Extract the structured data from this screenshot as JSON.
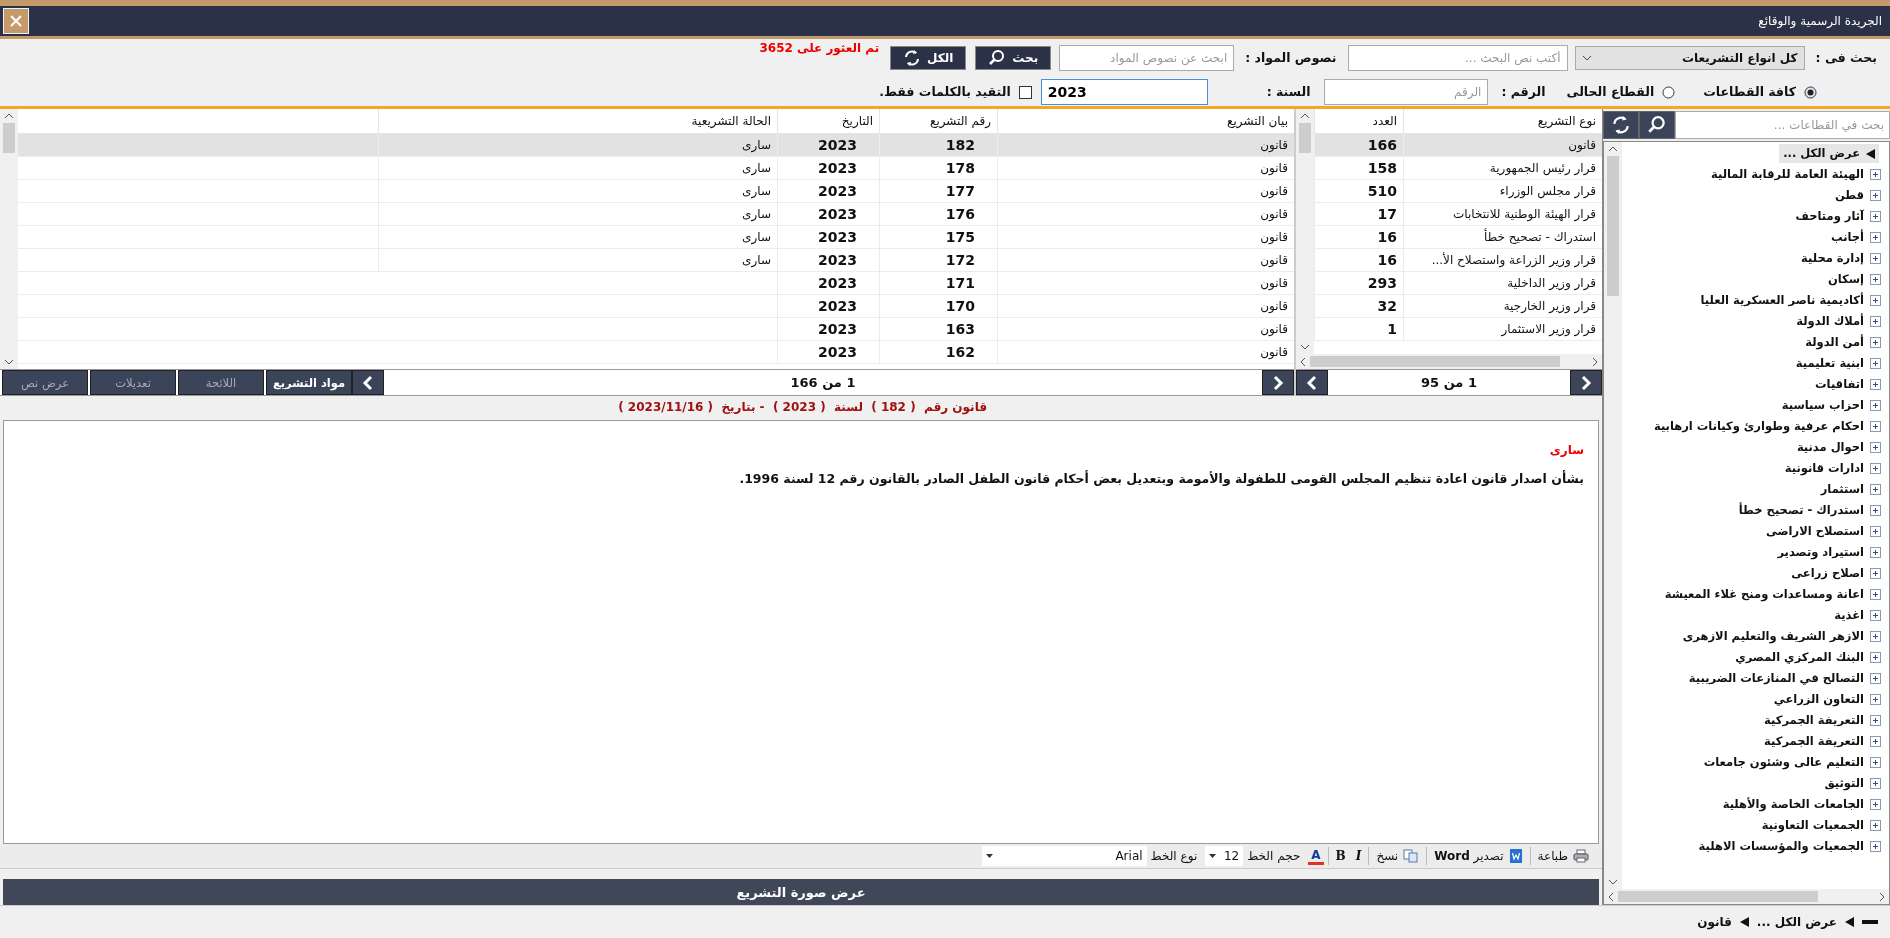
{
  "window": {
    "title": "الجريدة الرسمية والوقائع"
  },
  "search": {
    "scope_label": "بحث فى :",
    "type_dropdown": {
      "value": "كل انواع التشريعات"
    },
    "text_field": {
      "placeholder": "أكتب نص البحث ..."
    },
    "articles_label": "نصوص المواد :",
    "articles_field": {
      "placeholder": "ابحث عن نصوص المواد"
    },
    "search_button": "بحث",
    "all_button": "الكل",
    "result_text": "تم العثور على 3652",
    "sectors": [
      {
        "label": "كافة القطاعات",
        "selected": true
      },
      {
        "label": "القطاع الحالى",
        "selected": false
      }
    ],
    "number_label": "الرقم :",
    "number_field": {
      "placeholder": "الرقم"
    },
    "year_label": "السنة :",
    "year_field": {
      "value": "2023"
    },
    "exact_words": {
      "label": "التقيد بالكلمات فقط.",
      "checked": false
    }
  },
  "sectors_panel": {
    "search_field": {
      "placeholder": "بحث في القطاعات ..."
    },
    "tree": [
      {
        "label": "عرض الكل ...",
        "selected": true,
        "children": [
          {
            "label": "الهيئة العامة للرقابة المالية",
            "expanded": false,
            "selected": false
          },
          {
            "label": "قطن",
            "expanded": false,
            "selected": false
          },
          {
            "label": "آثار ومتاحف",
            "expanded": false,
            "selected": false
          },
          {
            "label": "أجانب",
            "expanded": false,
            "selected": false
          },
          {
            "label": "إدارة محلية",
            "expanded": false,
            "selected": false
          },
          {
            "label": "إسكان",
            "expanded": false,
            "selected": false
          },
          {
            "label": "أكاديمية ناصر العسكرية العليا",
            "expanded": false,
            "selected": false
          },
          {
            "label": "أملاك الدولة",
            "expanded": false,
            "selected": false
          },
          {
            "label": "أمن الدولة",
            "expanded": false,
            "selected": false
          },
          {
            "label": "ابنية تعليمية",
            "expanded": false,
            "selected": false
          },
          {
            "label": "اتفاقيات",
            "expanded": false,
            "selected": false
          },
          {
            "label": "احزاب سياسية",
            "expanded": false,
            "selected": false
          },
          {
            "label": "احكام عرفية وطوارئ  وكيانات ارهابية",
            "expanded": false,
            "selected": false
          },
          {
            "label": "احوال مدنية",
            "expanded": false,
            "selected": false
          },
          {
            "label": "ادارات قانونية",
            "expanded": false,
            "selected": false
          },
          {
            "label": "استثمار",
            "expanded": false,
            "selected": false
          },
          {
            "label": "استدراك - تصحيح خطأ",
            "expanded": false,
            "selected": false
          },
          {
            "label": "استصلاح الاراضى",
            "expanded": false,
            "selected": false
          },
          {
            "label": "استيراد وتصدير",
            "expanded": false,
            "selected": false
          },
          {
            "label": "اصلاح زراعى",
            "expanded": false,
            "selected": false
          },
          {
            "label": "اعانة ومساعدات ومنح غلاء المعيشة",
            "expanded": false,
            "selected": false
          },
          {
            "label": "اغذية",
            "expanded": false,
            "selected": false
          },
          {
            "label": "الازهر الشريف والتعليم الازهرى",
            "expanded": false,
            "selected": false
          },
          {
            "label": "البنك المركزي المصري",
            "expanded": false,
            "selected": false
          },
          {
            "label": "التصالح في المنازعات الضريبية",
            "expanded": false,
            "selected": false
          },
          {
            "label": "التعاون الزراعي",
            "expanded": false,
            "selected": false
          },
          {
            "label": "التعريفة الجمركية",
            "expanded": false,
            "selected": false
          },
          {
            "label": "التعريفة الجمركية",
            "expanded": false,
            "selected": false
          },
          {
            "label": "التعليم عالى وشئون جامعات",
            "expanded": false,
            "selected": false
          },
          {
            "label": "التوثيق",
            "expanded": false,
            "selected": false
          },
          {
            "label": "الجامعات الخاصة والأهلية",
            "expanded": false,
            "selected": false
          },
          {
            "label": "الجمعيات التعاونية",
            "expanded": false,
            "selected": false
          },
          {
            "label": "الجمعيات والمؤسسات الاهلية",
            "expanded": false,
            "selected": false
          }
        ]
      }
    ],
    "breadcrumb": [
      "عرض الكل ...",
      "قانون"
    ]
  },
  "types_table": {
    "columns": [
      "نوع التشريع",
      "العدد"
    ],
    "rows": [
      {
        "cells": [
          "قانون",
          "166"
        ],
        "selected": true
      },
      {
        "cells": [
          "قرار رئيس الجمهورية",
          "158"
        ],
        "selected": false
      },
      {
        "cells": [
          "قرار مجلس الوزراء",
          "510"
        ],
        "selected": false
      },
      {
        "cells": [
          "قرار الهيئة الوطنية للانتخابات",
          "17"
        ],
        "selected": false
      },
      {
        "cells": [
          "استدراك - تصحيح خطأ",
          "16"
        ],
        "selected": false
      },
      {
        "cells": [
          "قرار وزير الزراعة واستصلاح الأ...",
          "16"
        ],
        "selected": false
      },
      {
        "cells": [
          "قرار وزير الداخلية",
          "293"
        ],
        "selected": false
      },
      {
        "cells": [
          "قرار وزير الخارجية",
          "32"
        ],
        "selected": false
      },
      {
        "cells": [
          "قرار وزير الاستثمار",
          "1"
        ],
        "selected": false
      }
    ],
    "pager": "1 من 95"
  },
  "laws_table": {
    "columns": [
      "بيان التشريع",
      "رقم التشريع",
      "التاريخ",
      "الحالة التشريعية"
    ],
    "rows": [
      {
        "cells": [
          "قانون",
          "182",
          "2023",
          "سارى"
        ],
        "selected": true
      },
      {
        "cells": [
          "قانون",
          "178",
          "2023",
          "سارى"
        ],
        "selected": false
      },
      {
        "cells": [
          "قانون",
          "177",
          "2023",
          "سارى"
        ],
        "selected": false
      },
      {
        "cells": [
          "قانون",
          "176",
          "2023",
          "سارى"
        ],
        "selected": false
      },
      {
        "cells": [
          "قانون",
          "175",
          "2023",
          "سارى"
        ],
        "selected": false
      },
      {
        "cells": [
          "قانون",
          "172",
          "2023",
          "سارى"
        ],
        "selected": false
      },
      {
        "cells": [
          "قانون",
          "171",
          "2023"
        ],
        "selected": false
      },
      {
        "cells": [
          "قانون",
          "170",
          "2023"
        ],
        "selected": false
      },
      {
        "cells": [
          "قانون",
          "163",
          "2023"
        ],
        "selected": false
      },
      {
        "cells": [
          "قانون",
          "162",
          "2023"
        ],
        "selected": false
      }
    ],
    "pager": "1 من 166",
    "tabs": [
      {
        "label": "مواد التشريع",
        "selected": true
      },
      {
        "label": "اللائحة",
        "selected": false
      },
      {
        "label": "تعديلات",
        "selected": false
      },
      {
        "label": "عرض نص",
        "selected": false
      }
    ]
  },
  "details": {
    "caption": "قانون رقم  ( 182 )  لسنة  ( 2023 )  - بتاريخ  ( 2023/11/16 )",
    "status": "سارى",
    "text": "بشأن اصدار قانون اعادة تنظيم المجلس القومى للطفولة والأمومة وبتعديل بعض أحكام قانون الطفل الصادر بالقانون رقم 12 لسنة 1996.",
    "toolbar": {
      "print": "طباعة",
      "export": "تصدير **Word**",
      "copy": "نسخ",
      "italic": "I",
      "bold": "B",
      "font_color": "A",
      "size_label": "حجم الخط",
      "size_value": "12",
      "font_label": "نوع الخط",
      "font_value": "Arial"
    },
    "image_button": "عرض صورة التشريع"
  }
}
